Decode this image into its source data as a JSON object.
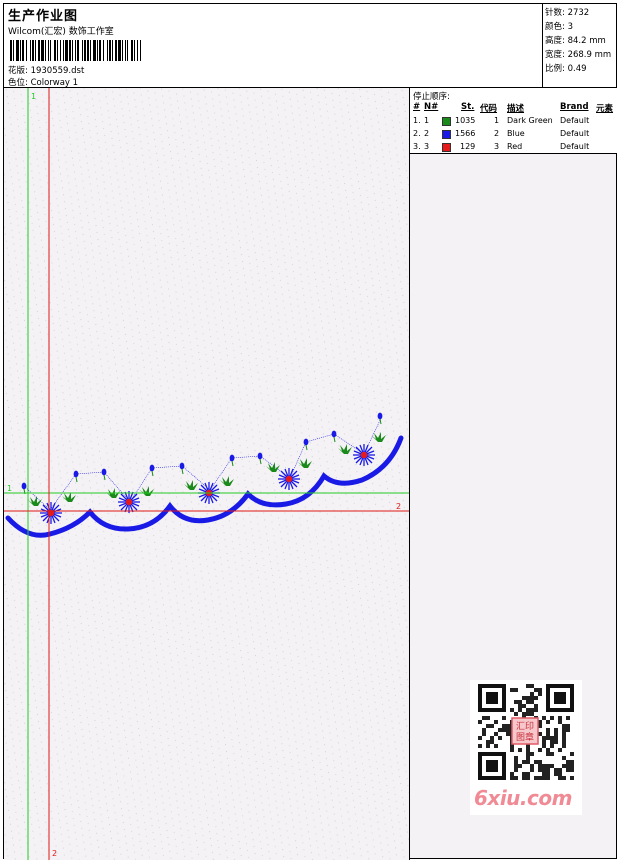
{
  "header": {
    "title": "生产作业图",
    "studio": "Wilcom(汇宏) 数饰工作室",
    "design_label": "花版:",
    "design_value": "1930559.dst",
    "colorway_label": "色位:",
    "colorway_value": "Colorway 1"
  },
  "stats": {
    "stitches_label": "针数:",
    "stitches_value": "2732",
    "colors_label": "颜色:",
    "colors_value": "3",
    "height_label": "高度:",
    "height_value": "84.2 mm",
    "width_label": "宽度:",
    "width_value": "268.9 mm",
    "scale_label": "比例:",
    "scale_value": "0.49"
  },
  "stop_sequence": {
    "title": "停止顺序:",
    "headers": {
      "num": "#",
      "n": "N#",
      "st": "St.",
      "code": "代码",
      "desc": "描述",
      "brand": "Brand",
      "element": "元素"
    },
    "rows": [
      {
        "num": "1.",
        "n": "1",
        "swatch_color": "#1a8a1a",
        "st": "1035",
        "code": "1",
        "desc": "Dark Green",
        "brand": "Default"
      },
      {
        "num": "2.",
        "n": "2",
        "swatch_color": "#1a1ae6",
        "st": "1566",
        "code": "2",
        "desc": "Blue",
        "brand": "Default"
      },
      {
        "num": "3.",
        "n": "3",
        "swatch_color": "#e61a1a",
        "st": "129",
        "code": "3",
        "desc": "Red",
        "brand": "Default"
      }
    ]
  },
  "guides": {
    "vertical_green_label": "1",
    "horizontal_green_label": "1",
    "horizontal_red_label": "2",
    "vertical_red_label": "2",
    "green_color": "#22cc22",
    "red_color": "#e01818"
  },
  "watermark": {
    "text": "6xiu.com",
    "qr_stamp_lines": [
      "汇印",
      "图章"
    ]
  }
}
